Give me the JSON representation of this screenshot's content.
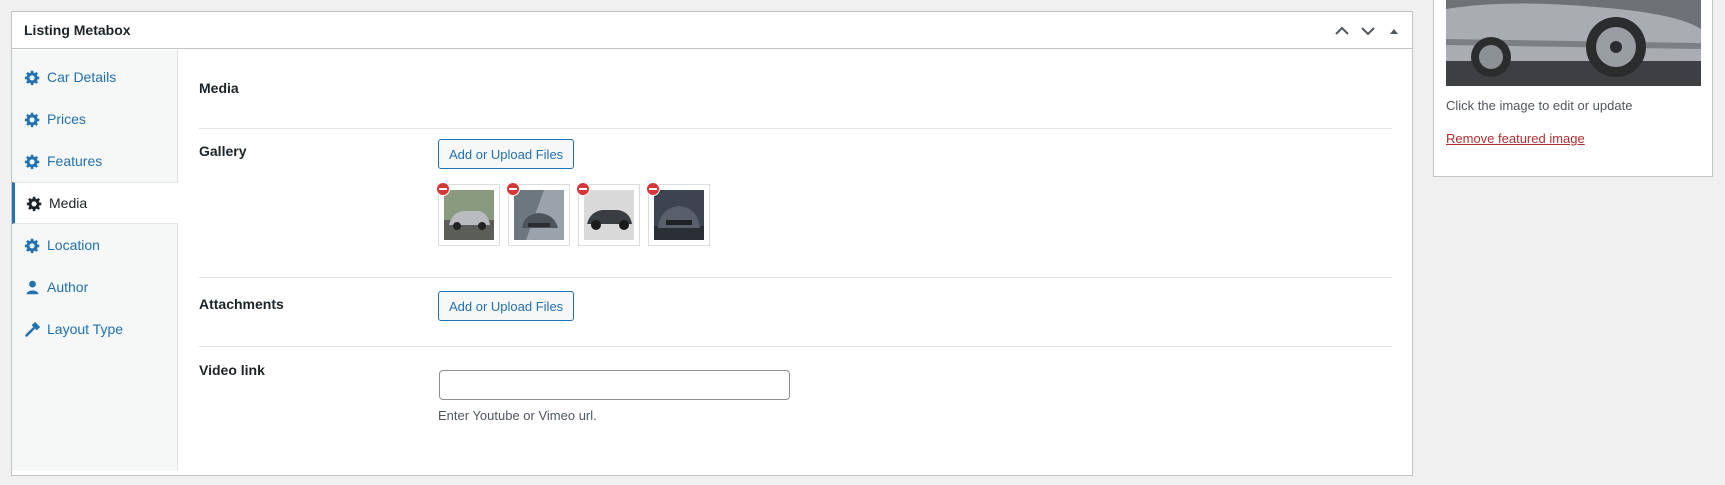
{
  "metabox": {
    "title": "Listing Metabox",
    "controls": [
      "chevron-up-icon",
      "chevron-down-icon",
      "triangle-up-icon"
    ]
  },
  "tabs": [
    {
      "label": "Car Details",
      "icon": "gear-icon",
      "active": false
    },
    {
      "label": "Prices",
      "icon": "gear-icon",
      "active": false
    },
    {
      "label": "Features",
      "icon": "gear-icon",
      "active": false
    },
    {
      "label": "Media",
      "icon": "gear-icon",
      "active": true
    },
    {
      "label": "Location",
      "icon": "gear-icon",
      "active": false
    },
    {
      "label": "Author",
      "icon": "user-icon",
      "active": false
    },
    {
      "label": "Layout Type",
      "icon": "hammer-icon",
      "active": false
    }
  ],
  "content": {
    "section_title": "Media",
    "gallery": {
      "label": "Gallery",
      "button": "Add or Upload Files",
      "thumbnails": [
        {
          "name": "silver-audi-suv"
        },
        {
          "name": "gray-audi-front"
        },
        {
          "name": "dark-audi-side"
        },
        {
          "name": "gray-audi-suv"
        }
      ]
    },
    "attachments": {
      "label": "Attachments",
      "button": "Add or Upload Files"
    },
    "video": {
      "label": "Video link",
      "value": "",
      "help": "Enter Youtube or Vimeo url."
    }
  },
  "featured": {
    "caption": "Click the image to edit or update",
    "remove_link": "Remove featured image"
  },
  "colors": {
    "accent": "#2271b1",
    "danger": "#d63638",
    "link_red": "#b32d2e"
  }
}
